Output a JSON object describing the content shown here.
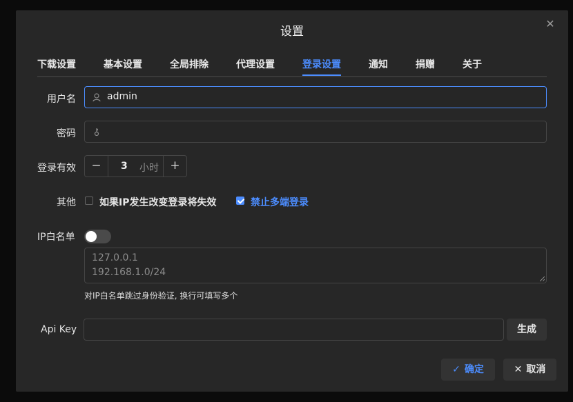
{
  "dialog": {
    "title": "设置",
    "close_icon": "close-icon"
  },
  "tabs": [
    {
      "label": "下载设置",
      "active": false
    },
    {
      "label": "基本设置",
      "active": false
    },
    {
      "label": "全局排除",
      "active": false
    },
    {
      "label": "代理设置",
      "active": false
    },
    {
      "label": "登录设置",
      "active": true
    },
    {
      "label": "通知",
      "active": false
    },
    {
      "label": "捐赠",
      "active": false
    },
    {
      "label": "关于",
      "active": false
    }
  ],
  "form": {
    "username": {
      "label": "用户名",
      "value": "admin",
      "icon": "user-icon"
    },
    "password": {
      "label": "密码",
      "value": "",
      "icon": "key-icon"
    },
    "validity": {
      "label": "登录有效",
      "value": "3",
      "unit": "小时",
      "minus": "−",
      "plus": "+"
    },
    "other": {
      "label": "其他",
      "ip_change_label": "如果IP发生改变登录将失效",
      "ip_change_checked": false,
      "single_login_label": "禁止多端登录",
      "single_login_checked": true
    },
    "ip_whitelist": {
      "label": "IP白名单",
      "enabled": false,
      "placeholder_lines": [
        "127.0.0.1",
        "192.168.1.0/24"
      ],
      "hint": "对IP白名单跳过身份验证, 换行可填写多个"
    },
    "api_key": {
      "label": "Api Key",
      "value": "",
      "generate_label": "生成"
    }
  },
  "footer": {
    "confirm_label": "确定",
    "cancel_label": "取消"
  },
  "colors": {
    "accent": "#4c8dff",
    "background": "#272727"
  }
}
